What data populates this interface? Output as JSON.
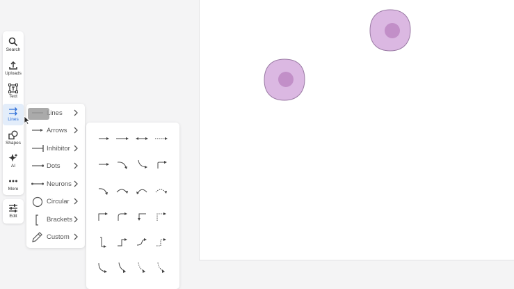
{
  "toolbar": {
    "items": [
      {
        "label": "Search",
        "icon": "search-icon"
      },
      {
        "label": "Uploads",
        "icon": "upload-icon"
      },
      {
        "label": "Text",
        "icon": "text-icon"
      },
      {
        "label": "Lines",
        "icon": "lines-icon",
        "active": true
      },
      {
        "label": "Shapes",
        "icon": "shapes-icon"
      },
      {
        "label": "AI",
        "icon": "ai-sparkle-icon"
      },
      {
        "label": "More",
        "icon": "more-dots-icon"
      }
    ],
    "edit": {
      "label": "Edit",
      "icon": "sliders-icon"
    }
  },
  "lines_menu": {
    "items": [
      {
        "label": "Lines",
        "icon": "line-icon"
      },
      {
        "label": "Arrows",
        "icon": "arrow-icon"
      },
      {
        "label": "Inhibitor",
        "icon": "inhibitor-icon"
      },
      {
        "label": "Dots",
        "icon": "dot-line-icon"
      },
      {
        "label": "Neurons",
        "icon": "neuron-line-icon"
      },
      {
        "label": "Circular",
        "icon": "circle-arrow-icon"
      },
      {
        "label": "Brackets",
        "icon": "bracket-icon"
      },
      {
        "label": "Custom",
        "icon": "pencil-icon"
      }
    ]
  },
  "arrow_panel": {
    "rows": [
      [
        "arrow-straight",
        "arrow-straight-long",
        "arrow-double",
        "arrow-dotted"
      ],
      [
        "arrow-straight",
        "arrow-curve-down",
        "arrow-hook-down",
        "arrow-elbow-up"
      ],
      [
        "arrow-arc-down",
        "arrow-arc",
        "arrow-arc-back",
        "arrow-arc-dotted"
      ],
      [
        "arrow-elbow-right",
        "arrow-elbow-round",
        "arrow-elbow-down",
        "arrow-elbow-dotted"
      ],
      [
        "arrow-zigzag-bracket",
        "arrow-step",
        "arrow-s-curve",
        "arrow-step-dotted"
      ],
      [
        "arrow-curve-corner",
        "arrow-curve-corner-long",
        "arrow-curve-corner-dashed",
        "arrow-curve-corner-dotted"
      ]
    ]
  },
  "colors": {
    "cell_fill": "#dbb8e2",
    "cell_stroke": "#9a7aa4",
    "nucleus": "#c28fc8",
    "accent": "#2e6fd8"
  }
}
